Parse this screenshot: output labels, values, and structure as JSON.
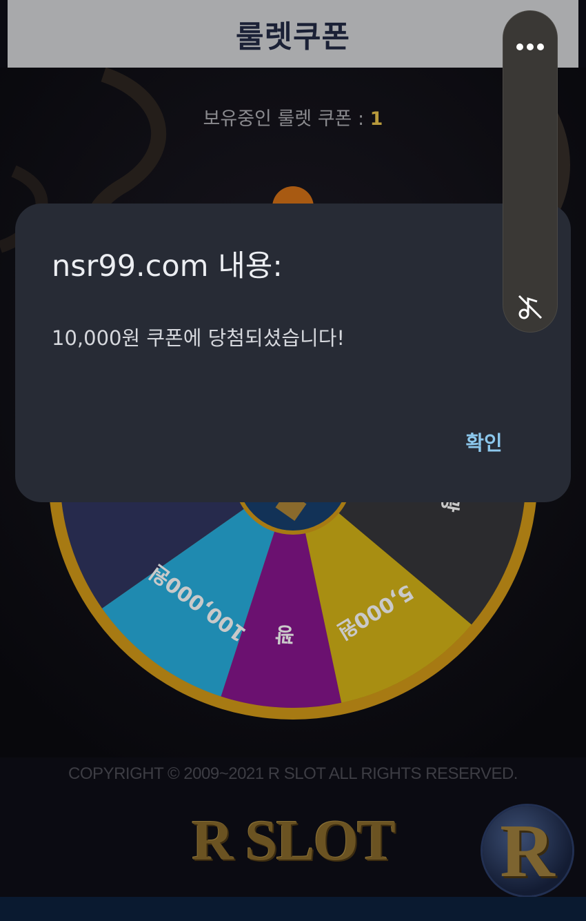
{
  "header": {
    "title": "룰렛쿠폰"
  },
  "coupon": {
    "label": "보유중인 룰렛 쿠폰 : ",
    "count": "1"
  },
  "wheel": {
    "segments": [
      {
        "label": "꽝",
        "color": "#262a4c"
      },
      {
        "label": "100,000원",
        "color": "#1f8ab0"
      },
      {
        "label": "꽝",
        "color": "#6b1170"
      },
      {
        "label": "5,000원",
        "color": "#a88e12"
      },
      {
        "label": "꽝",
        "color": "#2b2b2e"
      }
    ],
    "rim_color": "#a77a13"
  },
  "footer": {
    "copyright": "COPYRIGHT © 2009~2021 R SLOT ALL RIGHTS RESERVED.",
    "logo": "R SLOT",
    "badge": "R"
  },
  "dialog": {
    "title": "nsr99.com 내용:",
    "message": "10,000원 쿠폰에 당첨되셨습니다!",
    "ok_label": "확인"
  },
  "side_panel": {
    "icons": [
      "more-horizontal-icon",
      "mute-music-icon"
    ]
  }
}
